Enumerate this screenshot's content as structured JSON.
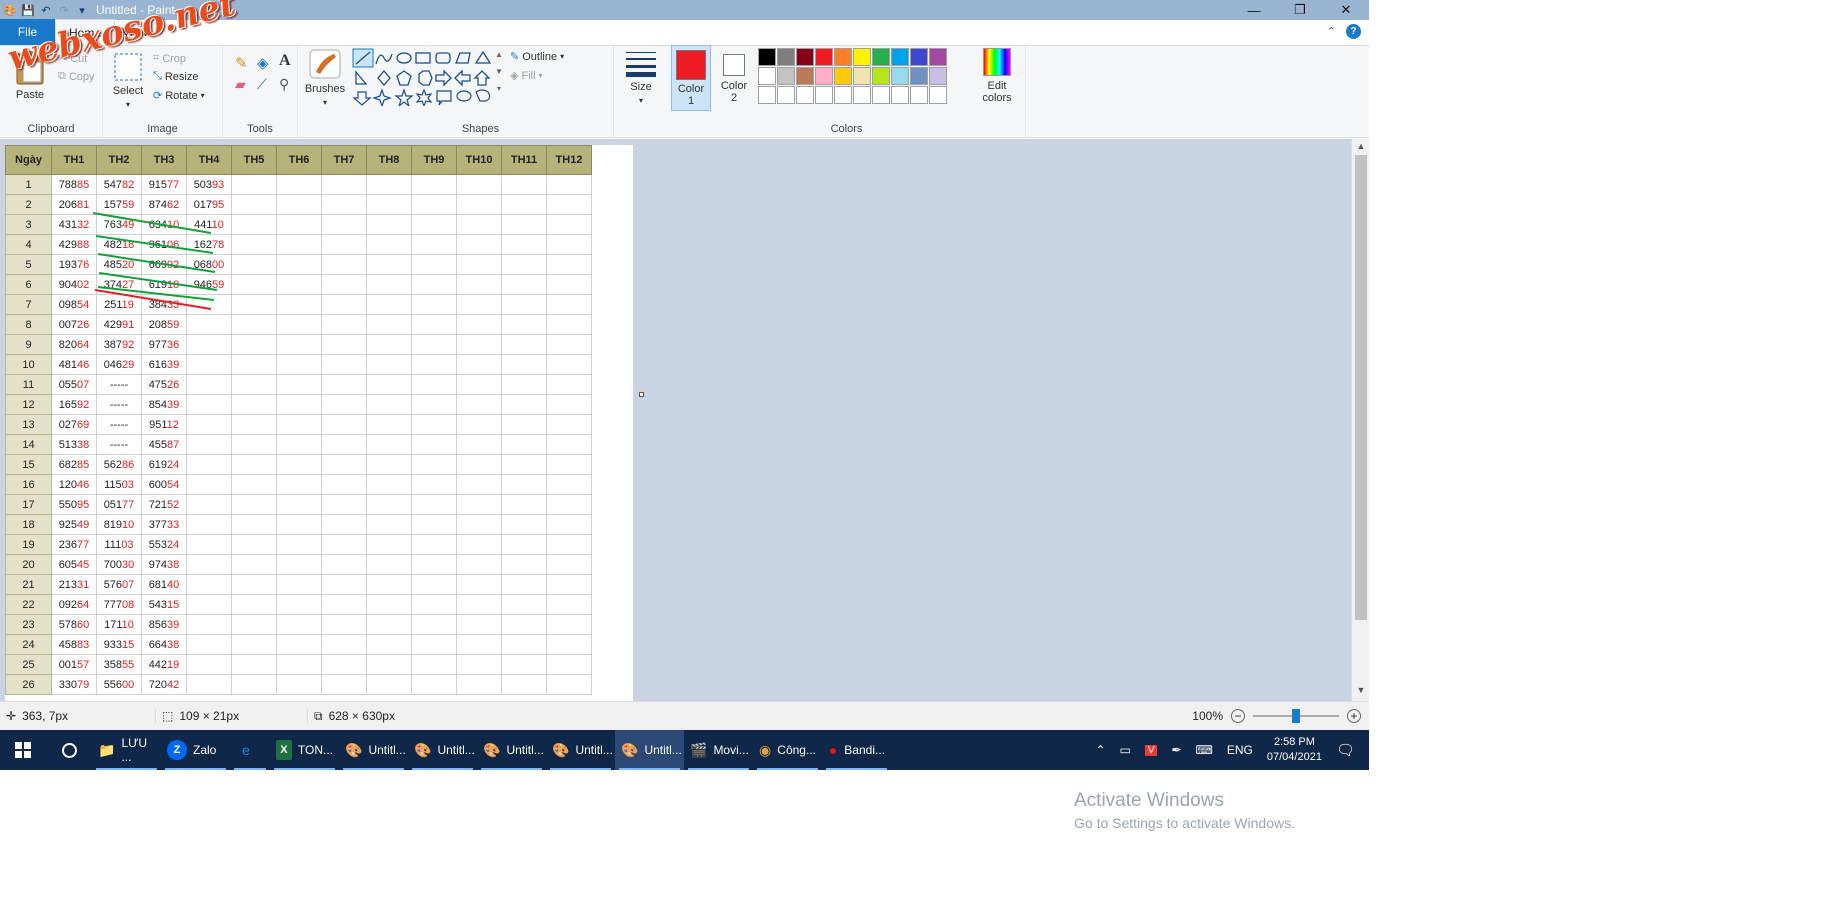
{
  "app": {
    "title": "Untitled - Paint",
    "watermark": "webxoso.net"
  },
  "tabs": {
    "file": "File",
    "home": "Home",
    "view": "View"
  },
  "ribbon": {
    "clipboard": {
      "paste": "Paste",
      "cut": "Cut",
      "copy": "Copy",
      "label": "Clipboard"
    },
    "image": {
      "select": "Select",
      "crop": "Crop",
      "resize": "Resize",
      "rotate": "Rotate",
      "label": "Image"
    },
    "tools": {
      "label": "Tools"
    },
    "brushes": {
      "label": "Brushes"
    },
    "shapes": {
      "outline": "Outline",
      "fill": "Fill",
      "label": "Shapes"
    },
    "size": {
      "label": "Size"
    },
    "color1": {
      "label": "Color",
      "num": "1",
      "value": "#ed1c24"
    },
    "color2": {
      "label": "Color",
      "num": "2",
      "value": "#ffffff"
    },
    "colors": {
      "label": "Colors",
      "edit_label": "Edit",
      "edit_label2": "colors",
      "row1": [
        "#000000",
        "#7f7f7f",
        "#880015",
        "#ed1c24",
        "#ff7f27",
        "#fff200",
        "#22b14c",
        "#00a2e8",
        "#3f48cc",
        "#a349a4"
      ],
      "row2": [
        "#ffffff",
        "#c3c3c3",
        "#b97a57",
        "#ffaec9",
        "#ffc90e",
        "#efe4b0",
        "#b5e61d",
        "#99d9ea",
        "#7092be",
        "#c8bfe7"
      ],
      "row3": [
        "#ffffff",
        "#ffffff",
        "#ffffff",
        "#ffffff",
        "#ffffff",
        "#ffffff",
        "#ffffff",
        "#ffffff",
        "#ffffff",
        "#ffffff"
      ]
    }
  },
  "sheet": {
    "headers": [
      "Ngày",
      "TH1",
      "TH2",
      "TH3",
      "TH4",
      "TH5",
      "TH6",
      "TH7",
      "TH8",
      "TH9",
      "TH10",
      "TH11",
      "TH12"
    ],
    "rows": [
      {
        "day": "1",
        "cells": [
          [
            "788",
            "85"
          ],
          [
            "547",
            "82"
          ],
          [
            "915",
            "77"
          ],
          [
            "503",
            "93"
          ]
        ]
      },
      {
        "day": "2",
        "cells": [
          [
            "206",
            "81"
          ],
          [
            "157",
            "59"
          ],
          [
            "874",
            "62"
          ],
          [
            "017",
            "95"
          ]
        ]
      },
      {
        "day": "3",
        "cells": [
          [
            "431",
            "32"
          ],
          [
            "763",
            "49"
          ],
          [
            "634",
            "10"
          ],
          [
            "441",
            "10"
          ]
        ]
      },
      {
        "day": "4",
        "cells": [
          [
            "429",
            "88"
          ],
          [
            "482",
            "18"
          ],
          [
            "961",
            "06"
          ],
          [
            "162",
            "78"
          ]
        ]
      },
      {
        "day": "5",
        "cells": [
          [
            "193",
            "76"
          ],
          [
            "485",
            "20"
          ],
          [
            "669",
            "92"
          ],
          [
            "068",
            "00"
          ]
        ]
      },
      {
        "day": "6",
        "cells": [
          [
            "904",
            "02"
          ],
          [
            "374",
            "27"
          ],
          [
            "619",
            "18"
          ],
          [
            "946",
            "59"
          ]
        ]
      },
      {
        "day": "7",
        "cells": [
          [
            "098",
            "54"
          ],
          [
            "251",
            "19"
          ],
          [
            "384",
            "33"
          ]
        ]
      },
      {
        "day": "8",
        "cells": [
          [
            "007",
            "26"
          ],
          [
            "429",
            "91"
          ],
          [
            "208",
            "59"
          ]
        ]
      },
      {
        "day": "9",
        "cells": [
          [
            "820",
            "64"
          ],
          [
            "387",
            "92"
          ],
          [
            "977",
            "36"
          ]
        ]
      },
      {
        "day": "10",
        "cells": [
          [
            "481",
            "46"
          ],
          [
            "046",
            "29"
          ],
          [
            "616",
            "39"
          ]
        ]
      },
      {
        "day": "11",
        "cells": [
          [
            "055",
            "07"
          ],
          [
            "-----",
            ""
          ],
          [
            "475",
            "26"
          ]
        ]
      },
      {
        "day": "12",
        "cells": [
          [
            "165",
            "92"
          ],
          [
            "-----",
            ""
          ],
          [
            "854",
            "39"
          ]
        ]
      },
      {
        "day": "13",
        "cells": [
          [
            "027",
            "69"
          ],
          [
            "-----",
            ""
          ],
          [
            "951",
            "12"
          ]
        ]
      },
      {
        "day": "14",
        "cells": [
          [
            "513",
            "38"
          ],
          [
            "-----",
            ""
          ],
          [
            "455",
            "87"
          ]
        ]
      },
      {
        "day": "15",
        "cells": [
          [
            "682",
            "85"
          ],
          [
            "562",
            "86"
          ],
          [
            "619",
            "24"
          ]
        ]
      },
      {
        "day": "16",
        "cells": [
          [
            "120",
            "46"
          ],
          [
            "115",
            "03"
          ],
          [
            "600",
            "54"
          ]
        ]
      },
      {
        "day": "17",
        "cells": [
          [
            "550",
            "95"
          ],
          [
            "051",
            "77"
          ],
          [
            "721",
            "52"
          ]
        ]
      },
      {
        "day": "18",
        "cells": [
          [
            "925",
            "49"
          ],
          [
            "819",
            "10"
          ],
          [
            "377",
            "33"
          ]
        ]
      },
      {
        "day": "19",
        "cells": [
          [
            "236",
            "77"
          ],
          [
            "111",
            "03"
          ],
          [
            "553",
            "24"
          ]
        ]
      },
      {
        "day": "20",
        "cells": [
          [
            "605",
            "45"
          ],
          [
            "700",
            "30"
          ],
          [
            "974",
            "38"
          ]
        ]
      },
      {
        "day": "21",
        "cells": [
          [
            "213",
            "31"
          ],
          [
            "576",
            "07"
          ],
          [
            "681",
            "40"
          ]
        ]
      },
      {
        "day": "22",
        "cells": [
          [
            "092",
            "64"
          ],
          [
            "777",
            "08"
          ],
          [
            "543",
            "15"
          ]
        ]
      },
      {
        "day": "23",
        "cells": [
          [
            "578",
            "60"
          ],
          [
            "171",
            "10"
          ],
          [
            "856",
            "39"
          ]
        ]
      },
      {
        "day": "24",
        "cells": [
          [
            "458",
            "83"
          ],
          [
            "933",
            "15"
          ],
          [
            "664",
            "38"
          ]
        ]
      },
      {
        "day": "25",
        "cells": [
          [
            "001",
            "57"
          ],
          [
            "358",
            "55"
          ],
          [
            "442",
            "19"
          ]
        ]
      },
      {
        "day": "26",
        "cells": [
          [
            "330",
            "79"
          ],
          [
            "556",
            "00"
          ],
          [
            "720",
            "42"
          ]
        ]
      }
    ]
  },
  "activate": {
    "line1": "Activate Windows",
    "line2": "Go to Settings to activate Windows."
  },
  "status": {
    "cursor": "363, 7px",
    "selection": "109 × 21px",
    "canvas_size": "628 × 630px",
    "zoom": "100%",
    "zoom_level": 0.5
  },
  "taskbar": {
    "items": [
      {
        "label": "LƯU ...",
        "icon": "folder-icon"
      },
      {
        "label": "Zalo",
        "icon": "zalo-icon"
      },
      {
        "label": "",
        "icon": "edge-icon"
      },
      {
        "label": "TON...",
        "icon": "excel-icon"
      },
      {
        "label": "Untitl...",
        "icon": "paint-icon"
      },
      {
        "label": "Untitl...",
        "icon": "paint-icon"
      },
      {
        "label": "Untitl...",
        "icon": "paint-icon"
      },
      {
        "label": "Untitl...",
        "icon": "paint-icon"
      },
      {
        "label": "Untitl...",
        "icon": "paint-icon"
      },
      {
        "label": "Movi...",
        "icon": "movie-icon"
      },
      {
        "label": "Công...",
        "icon": "chrome-icon"
      },
      {
        "label": "Bandi...",
        "icon": "bandicam-icon"
      }
    ],
    "lang": "ENG",
    "time": "2:58 PM",
    "date": "07/04/2021"
  }
}
